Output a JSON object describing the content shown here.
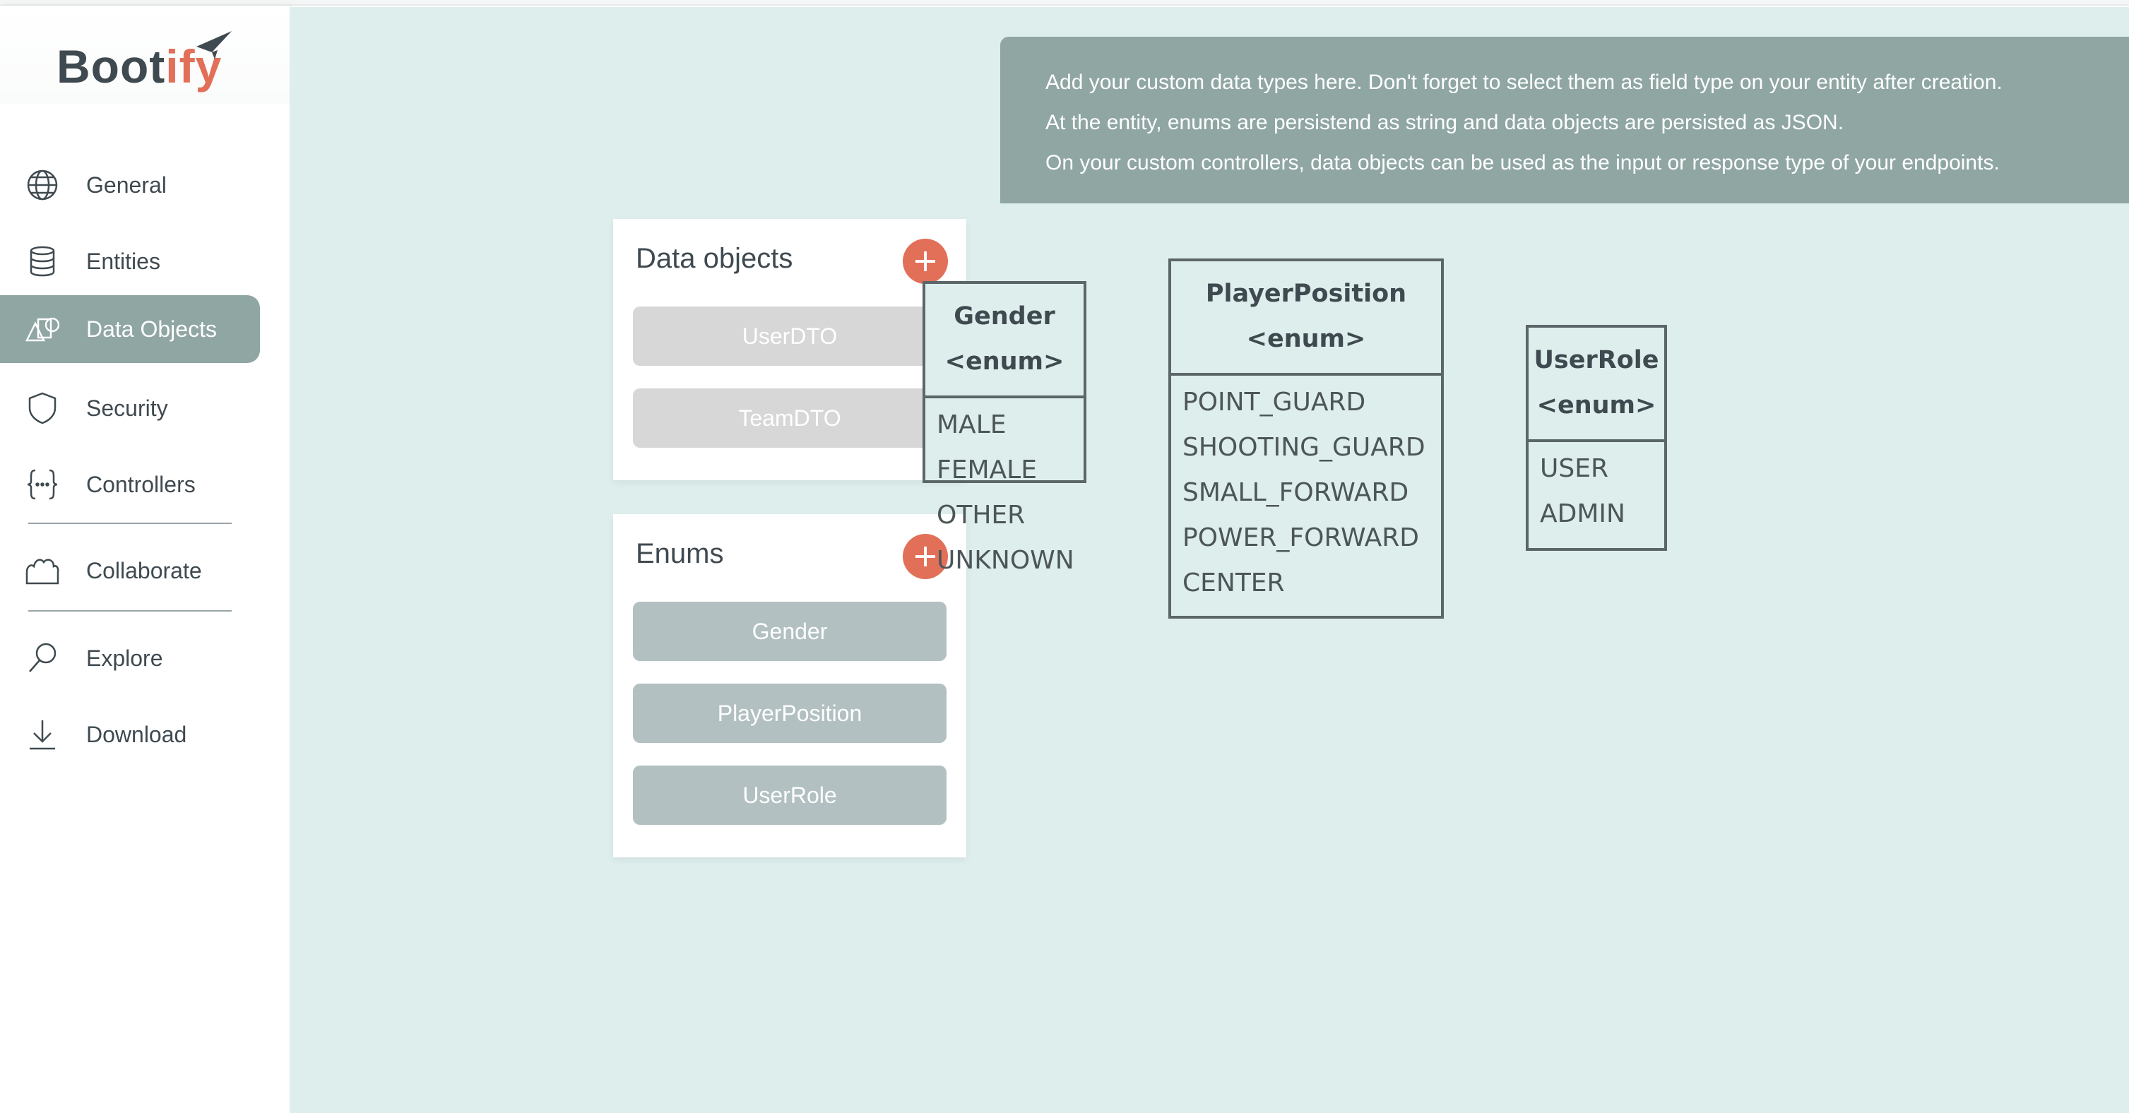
{
  "app": {
    "logo_main": "Boot",
    "logo_accent": "ify",
    "brand_color": "#e27058",
    "accent_color": "#8fa6a3"
  },
  "sidebar": {
    "items": [
      {
        "label": "General",
        "icon": "globe-icon"
      },
      {
        "label": "Entities",
        "icon": "database-icon"
      },
      {
        "label": "Data Objects",
        "icon": "shapes-icon",
        "active": true
      },
      {
        "label": "Security",
        "icon": "shield-icon"
      },
      {
        "label": "Controllers",
        "icon": "braces-icon"
      },
      {
        "label": "Collaborate",
        "icon": "users-icon"
      },
      {
        "label": "Explore",
        "icon": "magnifier-icon"
      },
      {
        "label": "Download",
        "icon": "download-icon"
      }
    ]
  },
  "info": {
    "lines": [
      "Add your custom data types here. Don't forget to select them as field type on your entity after creation.",
      "At the entity, enums are persistend as string and data objects are persisted as JSON.",
      "On your custom controllers, data objects can be used as the input or response type of your endpoints."
    ]
  },
  "data_objects": {
    "title": "Data objects",
    "items": [
      "UserDTO",
      "TeamDTO"
    ]
  },
  "enums": {
    "title": "Enums",
    "items": [
      "Gender",
      "PlayerPosition",
      "UserRole"
    ]
  },
  "diagram": {
    "stereotype": "<enum>",
    "boxes": [
      {
        "name": "Gender",
        "values": [
          "MALE",
          "FEMALE",
          "OTHER",
          "UNKNOWN"
        ]
      },
      {
        "name": "PlayerPosition",
        "values": [
          "POINT_GUARD",
          "SHOOTING_GUARD",
          "SMALL_FORWARD",
          "POWER_FORWARD",
          "CENTER"
        ]
      },
      {
        "name": "UserRole",
        "values": [
          "USER",
          "ADMIN"
        ]
      }
    ]
  }
}
